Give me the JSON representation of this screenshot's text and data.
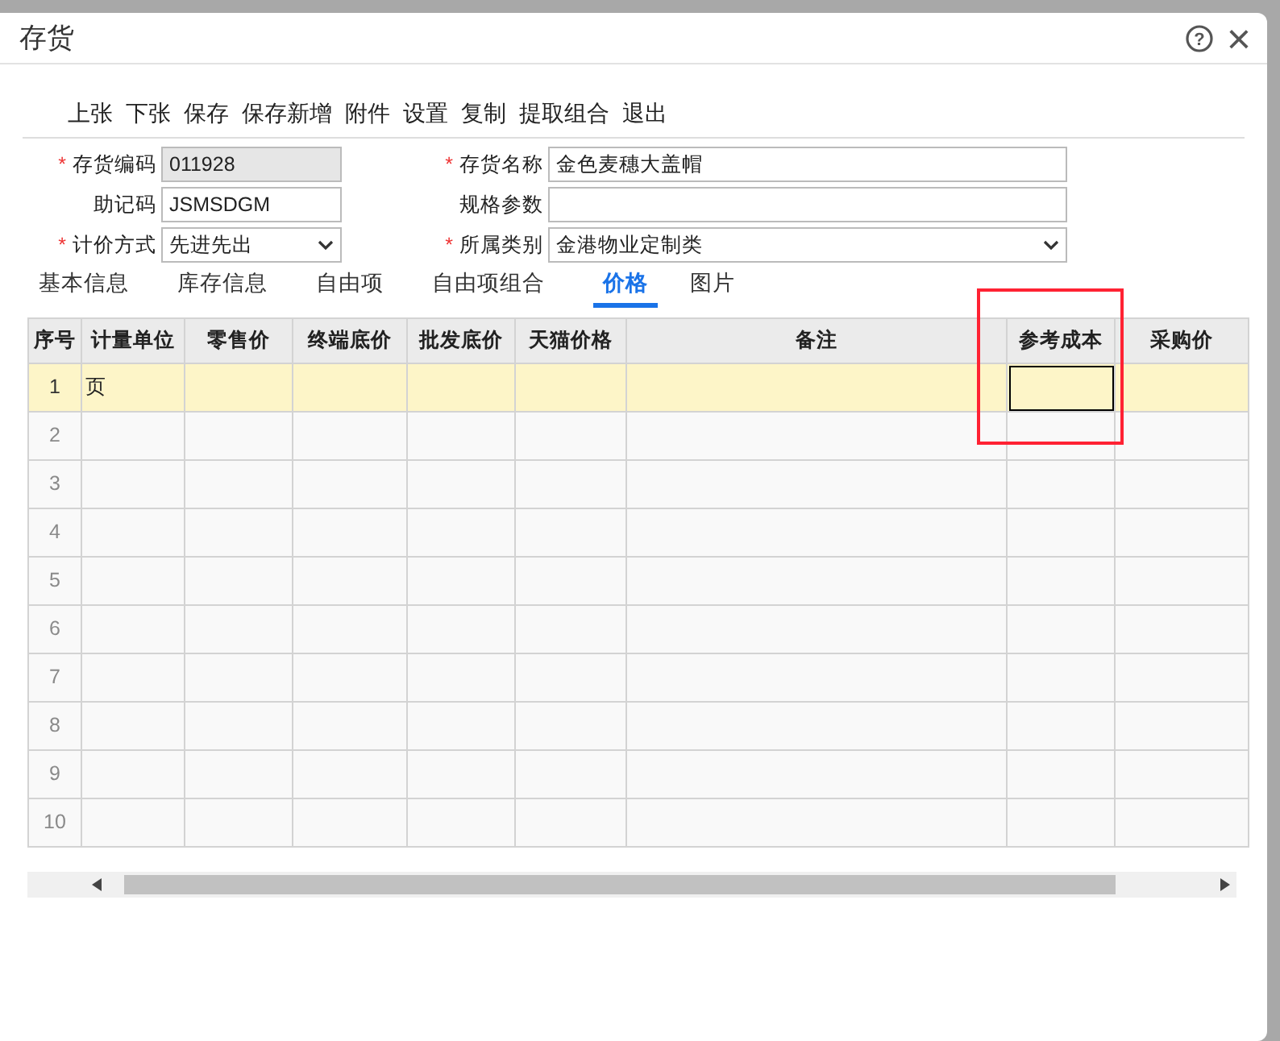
{
  "window": {
    "title": "存货",
    "help": "?",
    "close": "×"
  },
  "required_mark": "*",
  "toolbar": [
    "上张",
    "下张",
    "保存",
    "保存新增",
    "附件",
    "设置",
    "复制",
    "提取组合",
    "退出"
  ],
  "fields": [
    {
      "label": "存货编码",
      "required": true,
      "kind": "text",
      "value": "011928",
      "disabled": true
    },
    {
      "label": "存货名称",
      "required": true,
      "kind": "text",
      "value": "金色麦穗大盖帽",
      "disabled": false
    },
    {
      "label": "助记码",
      "required": false,
      "kind": "text",
      "value": "JSMSDGM",
      "disabled": false
    },
    {
      "label": "规格参数",
      "required": false,
      "kind": "text",
      "disabled": false
    },
    {
      "label": "计价方式",
      "required": true,
      "kind": "select",
      "value": "先进先出",
      "disabled": false
    },
    {
      "label": "所属类别",
      "required": true,
      "kind": "select",
      "value": "金港物业定制类",
      "disabled": false
    }
  ],
  "tabs": [
    {
      "label": "基本信息",
      "selected": false
    },
    {
      "label": "库存信息",
      "selected": false
    },
    {
      "label": "自由项",
      "selected": false
    },
    {
      "label": "自由项组合",
      "selected": false
    },
    {
      "label": "价格",
      "selected": true
    },
    {
      "label": "图片",
      "selected": false
    }
  ],
  "table": {
    "columns": [
      {
        "label": "序号",
        "highlighted": false
      },
      {
        "label": "计量单位",
        "highlighted": false
      },
      {
        "label": "零售价",
        "highlighted": false
      },
      {
        "label": "终端底价",
        "highlighted": false
      },
      {
        "label": "批发底价",
        "highlighted": false
      },
      {
        "label": "天猫价格",
        "highlighted": false
      },
      {
        "label": "备注",
        "highlighted": false
      },
      {
        "label": "参考成本",
        "highlighted": true
      },
      {
        "label": "采购价",
        "highlighted": false
      }
    ],
    "rows": [
      {
        "number": "1",
        "selected": true,
        "unit": "页",
        "cost_cell_focused": true
      },
      {
        "number": "2",
        "selected": false,
        "cost_cell_focused": false
      },
      {
        "number": "3",
        "selected": false,
        "cost_cell_focused": false
      },
      {
        "number": "4",
        "selected": false,
        "cost_cell_focused": false
      },
      {
        "number": "5",
        "selected": false,
        "cost_cell_focused": false
      },
      {
        "number": "6",
        "selected": false,
        "cost_cell_focused": false
      },
      {
        "number": "7",
        "selected": false,
        "cost_cell_focused": false
      },
      {
        "number": "8",
        "selected": false,
        "cost_cell_focused": false
      },
      {
        "number": "9",
        "selected": false,
        "cost_cell_focused": false
      },
      {
        "number": "10",
        "selected": false,
        "cost_cell_focused": false
      }
    ]
  }
}
